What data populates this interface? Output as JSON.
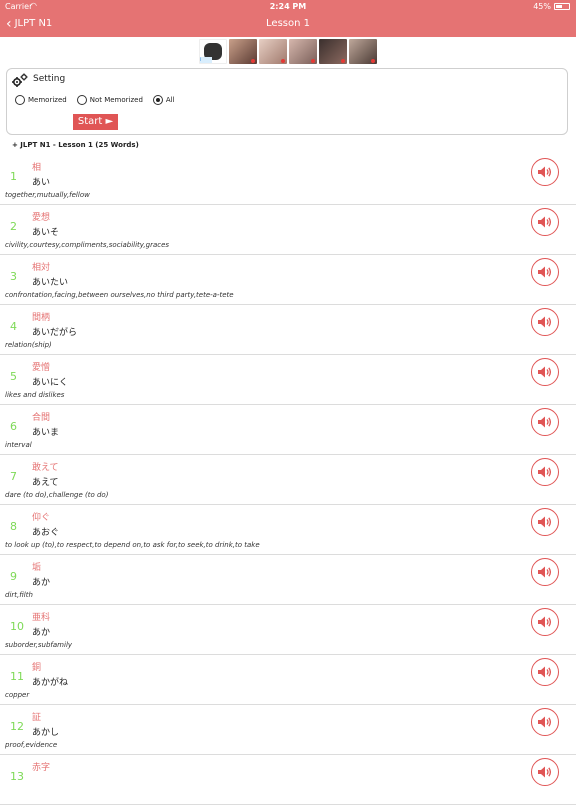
{
  "status": {
    "carrier": "Carrier",
    "time": "2:24 PM",
    "battery": "45%"
  },
  "nav": {
    "back_label": "JLPT N1",
    "title": "Lesson 1"
  },
  "colors": {
    "brand": "#e57373",
    "number": "#7ed957",
    "accent": "#e05555"
  },
  "setting": {
    "title": "Setting",
    "options": [
      "Memorized",
      "Not Memorized",
      "All"
    ],
    "selected": "All",
    "start_label": "Start ►"
  },
  "lesson_header": "+ JLPT N1 - Lesson 1  (25 Words)",
  "words": [
    {
      "num": "1",
      "kanji": "相",
      "kana": "あい",
      "meaning": "together,mutually,fellow"
    },
    {
      "num": "2",
      "kanji": "愛想",
      "kana": "あいそ",
      "meaning": "civility,courtesy,compliments,sociability,graces"
    },
    {
      "num": "3",
      "kanji": "相対",
      "kana": "あいたい",
      "meaning": "confrontation,facing,between ourselves,no third party,tete-a-tete"
    },
    {
      "num": "4",
      "kanji": "間柄",
      "kana": "あいだがら",
      "meaning": "relation(ship)"
    },
    {
      "num": "5",
      "kanji": "愛憎",
      "kana": "あいにく",
      "meaning": "likes and dislikes"
    },
    {
      "num": "6",
      "kanji": "合間",
      "kana": "あいま",
      "meaning": "interval"
    },
    {
      "num": "7",
      "kanji": "敢えて",
      "kana": "あえて",
      "meaning": "dare (to do),challenge (to do)"
    },
    {
      "num": "8",
      "kanji": "仰ぐ",
      "kana": "あおぐ",
      "meaning": "to look up (to),to respect,to depend on,to ask for,to seek,to drink,to take"
    },
    {
      "num": "9",
      "kanji": "垢",
      "kana": "あか",
      "meaning": "dirt,filth"
    },
    {
      "num": "10",
      "kanji": "亜科",
      "kana": "あか",
      "meaning": "suborder,subfamily"
    },
    {
      "num": "11",
      "kanji": "銅",
      "kana": "あかがね",
      "meaning": "copper"
    },
    {
      "num": "12",
      "kanji": "証",
      "kana": "あかし",
      "meaning": "proof,evidence"
    },
    {
      "num": "13",
      "kanji": "赤字",
      "kana": "",
      "meaning": ""
    }
  ]
}
